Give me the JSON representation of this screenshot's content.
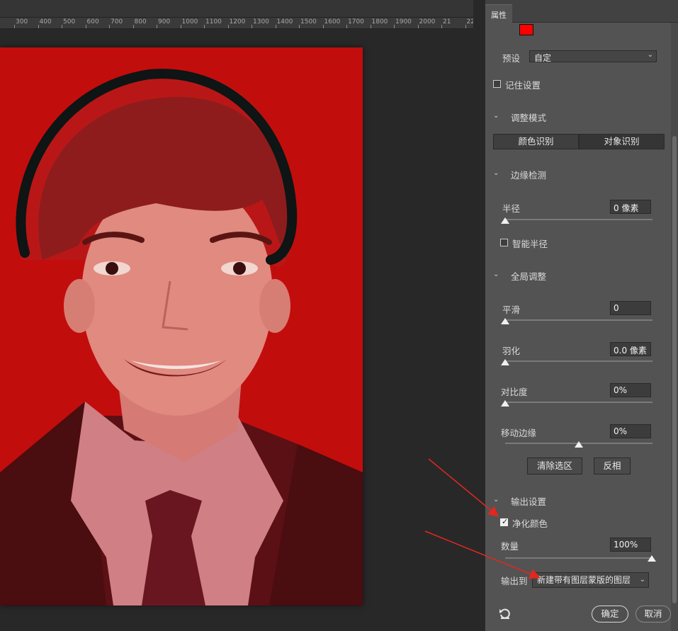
{
  "ruler": {
    "ticks": [
      "300",
      "400",
      "500",
      "600",
      "700",
      "800",
      "900",
      "1000",
      "1100",
      "1200",
      "1300",
      "1400",
      "1500",
      "1600",
      "1700",
      "1800",
      "1900",
      "2000",
      "21",
      "22"
    ]
  },
  "panel": {
    "tab_label": "属性",
    "swatch_color": "#ff0000",
    "preset_label": "预设",
    "preset_value": "自定",
    "remember_settings": "记住设置",
    "adjust_mode": {
      "title": "调整模式",
      "color_aware": "颜色识别",
      "object_aware": "对象识别"
    },
    "edge_detection": {
      "title": "边缘检测",
      "radius_label": "半径",
      "radius_value": "0 像素",
      "smart_radius": "智能半径"
    },
    "global_refinements": {
      "title": "全局调整",
      "smooth_label": "平滑",
      "smooth_value": "0",
      "smooth_level": 0,
      "feather_label": "羽化",
      "feather_value": "0.0 像素",
      "feather_level": 0,
      "contrast_label": "对比度",
      "contrast_value": "0%",
      "contrast_level": 0,
      "shift_edge_label": "移动边缘",
      "shift_edge_value": "0%",
      "shift_edge_level": 0.5,
      "clear_selection": "清除选区",
      "invert": "反相"
    },
    "output_settings": {
      "title": "输出设置",
      "decontaminate": "净化颜色",
      "decontaminate_checked": true,
      "amount_label": "数量",
      "amount_value": "100%",
      "amount_level": 1,
      "output_to_label": "输出到",
      "output_to_value": "新建带有图层蒙版的图层"
    },
    "ok_button": "确定",
    "cancel_button": "取消"
  },
  "colors": {
    "panel_bg": "#535353",
    "canvas_bg": "#282828",
    "overlay_red": "#c20d0d",
    "annotation_arrow": "#e0281e"
  }
}
